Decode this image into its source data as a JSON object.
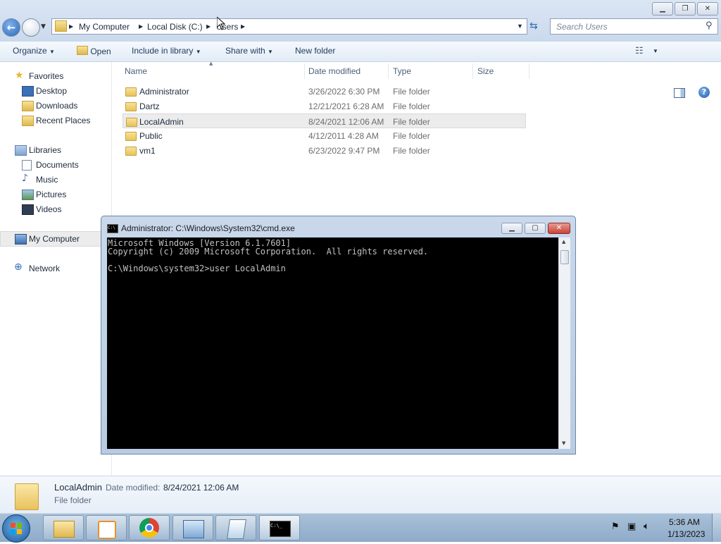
{
  "explorer": {
    "address": {
      "crumbs": [
        "My Computer",
        "Local Disk (C:)",
        "Users"
      ]
    },
    "search_placeholder": "Search Users",
    "toolbar": {
      "organize": "Organize",
      "open": "Open",
      "include_in_library": "Include in library",
      "share_with": "Share with",
      "new_folder": "New folder"
    },
    "nav": {
      "favorites": "Favorites",
      "desktop": "Desktop",
      "downloads": "Downloads",
      "recent_places": "Recent Places",
      "libraries": "Libraries",
      "documents": "Documents",
      "music": "Music",
      "pictures": "Pictures",
      "videos": "Videos",
      "my_computer": "My Computer",
      "network": "Network"
    },
    "columns": {
      "name": "Name",
      "date": "Date modified",
      "type": "Type",
      "size": "Size"
    },
    "files": [
      {
        "name": "Administrator",
        "date": "3/26/2022 6:30 PM",
        "type": "File folder"
      },
      {
        "name": "Dartz",
        "date": "12/21/2021 6:28 AM",
        "type": "File folder"
      },
      {
        "name": "LocalAdmin",
        "date": "8/24/2021 12:06 AM",
        "type": "File folder"
      },
      {
        "name": "Public",
        "date": "4/12/2011 4:28 AM",
        "type": "File folder"
      },
      {
        "name": "vm1",
        "date": "6/23/2022 9:47 PM",
        "type": "File folder"
      }
    ],
    "selected_index": 2,
    "details": {
      "name": "LocalAdmin",
      "date_label": "Date modified:",
      "date": "8/24/2021 12:06 AM",
      "type": "File folder"
    }
  },
  "cmd": {
    "title": "Administrator: C:\\Windows\\System32\\cmd.exe",
    "line1": "Microsoft Windows [Version 6.1.7601]",
    "line2": "Copyright (c) 2009 Microsoft Corporation.  All rights reserved.",
    "line3": "C:\\Windows\\system32>user LocalAdmin"
  },
  "taskbar": {
    "time": "5:36 AM",
    "date": "1/13/2023",
    "cmd_icon_text": "C:\\_"
  },
  "colors": {
    "accent": "#1e395b",
    "selection": "#ececec",
    "console_bg": "#000000",
    "console_fg": "#c0c0c0",
    "close_button": "#c8453a"
  }
}
